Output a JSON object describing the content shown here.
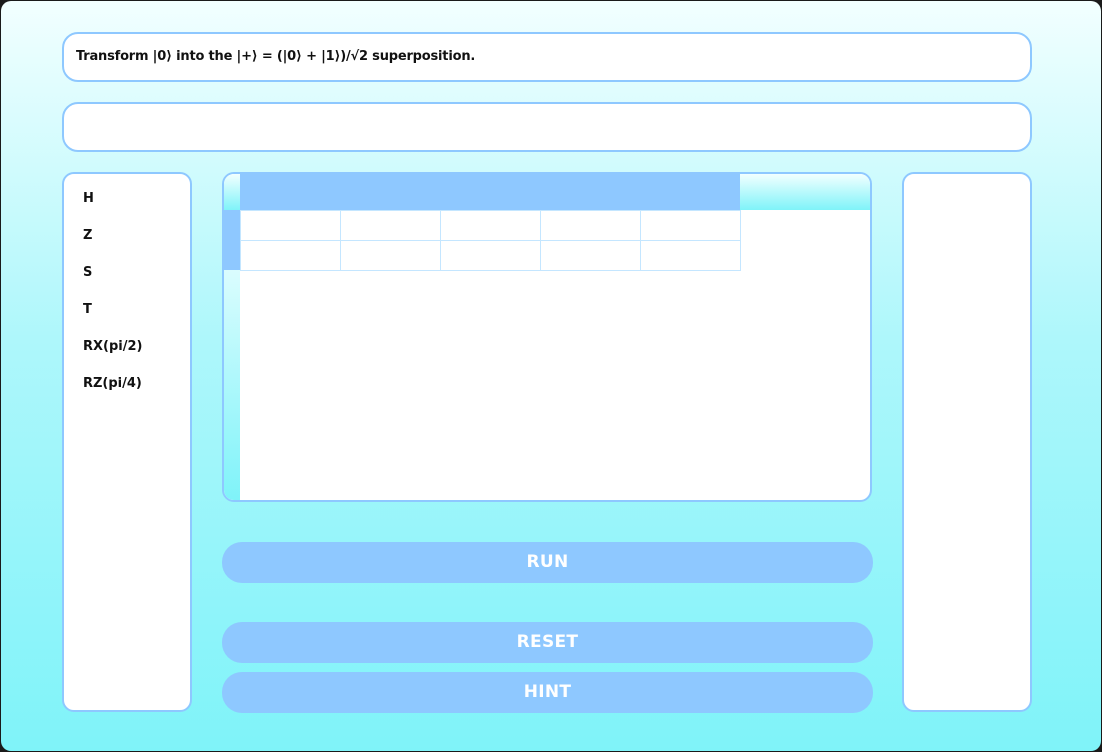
{
  "task": {
    "text": "Transform |0⟩ into the |+⟩ = (|0⟩ + |1⟩)/√2 superposition."
  },
  "message": {
    "text": ""
  },
  "gates": [
    {
      "label": "H"
    },
    {
      "label": "Z"
    },
    {
      "label": "S"
    },
    {
      "label": "T"
    },
    {
      "label": "RX(pi/2)"
    },
    {
      "label": "RZ(pi/4)"
    }
  ],
  "buttons": {
    "run": "RUN",
    "reset": "RESET",
    "hint": "HINT"
  },
  "colors": {
    "accent": "#8ec8ff",
    "panel_border": "#8ec8ff",
    "button_text": "#ffffff"
  }
}
